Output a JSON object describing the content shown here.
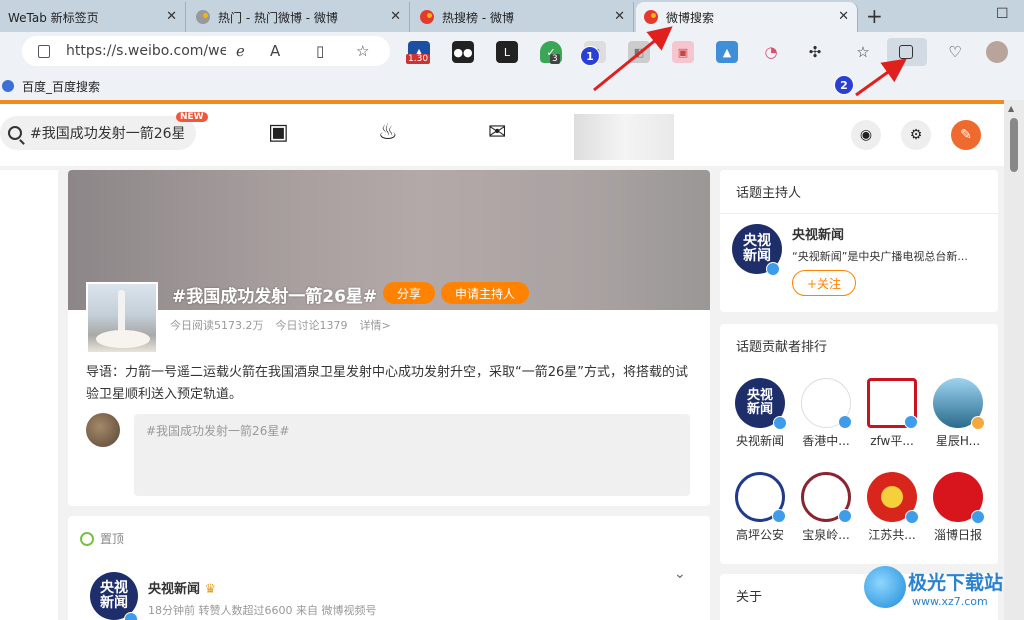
{
  "browser": {
    "tabs": [
      {
        "label": "WeTab 新标签页"
      },
      {
        "label": "热门 - 热门微博 - 微博"
      },
      {
        "label": "热搜榜 - 微博"
      },
      {
        "label": "微博搜索"
      }
    ],
    "url": "https://s.weibo.com/we...",
    "extension_badges": {
      "ext1": "1.30",
      "ext_shield": "3"
    },
    "bookmark": "百度_百度搜索"
  },
  "header": {
    "search_text": "#我国成功发射一箭26星",
    "new_badge": "NEW"
  },
  "topic": {
    "title": "#我国成功发射一箭26星#",
    "share_label": "分享",
    "apply_host_label": "申请主持人",
    "reads": "今日阅读5173.2万",
    "discussions": "今日讨论1379",
    "details": "详情>",
    "intro": "导语：力箭一号遥二运载火箭在我国酒泉卫星发射中心成功发射升空，采取“一箭26星”方式，将搭载的试验卫星顺利送入预定轨道。",
    "comment_placeholder": "#我国成功发射一箭26星#"
  },
  "post": {
    "pinned_label": "置顶",
    "author": "央视新闻",
    "meta": "18分钟前 转赞人数超过6600  来自 微博视频号"
  },
  "sidebar": {
    "host_title": "话题主持人",
    "host_name": "央视新闻",
    "host_desc": "“央视新闻”是中央广播电视总台新...",
    "follow_label": "+关注",
    "contrib_title": "话题贡献者排行",
    "contributors": [
      {
        "name": "央视新闻"
      },
      {
        "name": "香港中..."
      },
      {
        "name": "zfw平..."
      },
      {
        "name": "星辰H..."
      },
      {
        "name": "高坪公安"
      },
      {
        "name": "宝泉岭..."
      },
      {
        "name": "江苏共..."
      },
      {
        "name": "淄博日报"
      }
    ],
    "about_title": "关于"
  },
  "logo_text": {
    "cctv_line1": "央视",
    "cctv_line2": "新闻"
  },
  "annotations": {
    "marker1": "1",
    "marker2": "2"
  },
  "watermark": {
    "name": "极光下载站",
    "url": "www.xz7.com"
  },
  "colors": {
    "accent": "#ff8200",
    "header_line": "#f08c1d",
    "arrow": "#e0201c"
  }
}
